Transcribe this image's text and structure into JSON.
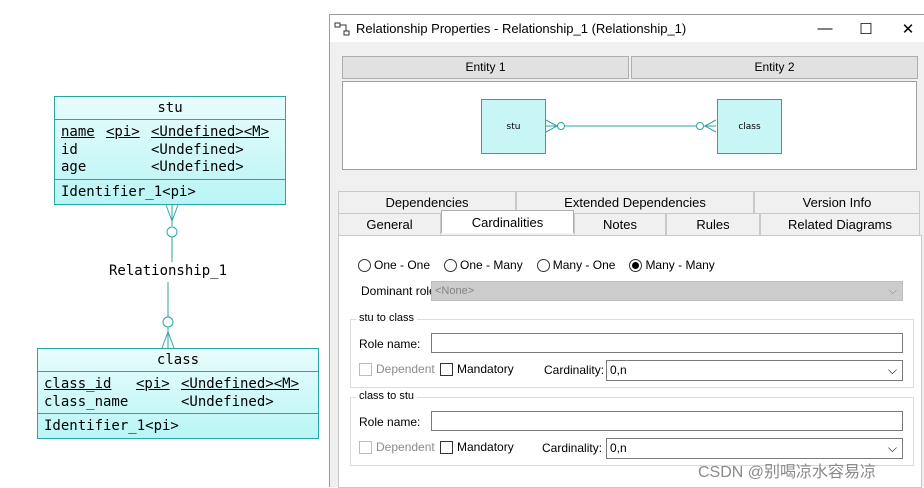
{
  "diagram": {
    "entity_stu": {
      "name": "stu",
      "attributes": [
        {
          "name": "name",
          "pi": "<pi>",
          "type": "<Undefined>",
          "mandatory": "<M>",
          "underline": true
        },
        {
          "name": "id",
          "pi": "",
          "type": "<Undefined>",
          "mandatory": "",
          "underline": false
        },
        {
          "name": "age",
          "pi": "",
          "type": "<Undefined>",
          "mandatory": "",
          "underline": false
        }
      ],
      "identifier": "Identifier_1<pi>"
    },
    "relationship_label": "Relationship_1",
    "entity_class": {
      "name": "class",
      "attributes": [
        {
          "name": "class_id",
          "pi": "<pi>",
          "type": "<Undefined>",
          "mandatory": "<M>",
          "underline": true
        },
        {
          "name": "class_name",
          "pi": "",
          "type": "<Undefined>",
          "mandatory": "",
          "underline": false
        }
      ],
      "identifier": "Identifier_1<pi>"
    }
  },
  "dialog": {
    "title": "Relationship Properties - Relationship_1 (Relationship_1)",
    "window_buttons": {
      "minimize": "—",
      "maximize": "☐",
      "close": "✕"
    },
    "entity_tabs": [
      "Entity 1",
      "Entity 2"
    ],
    "preview": {
      "left_entity": "stu",
      "right_entity": "class"
    },
    "tabs_row1": [
      "Dependencies",
      "Extended Dependencies",
      "Version Info"
    ],
    "tabs_row2": [
      "General",
      "Cardinalities",
      "Notes",
      "Rules",
      "Related Diagrams"
    ],
    "active_tab": "Cardinalities",
    "cardinality_options": [
      {
        "label": "One - One",
        "checked": false
      },
      {
        "label": "One - Many",
        "checked": false
      },
      {
        "label": "Many - One",
        "checked": false
      },
      {
        "label": "Many - Many",
        "checked": true
      }
    ],
    "dominant_role": {
      "label": "Dominant role:",
      "value": "<None>"
    },
    "group1": {
      "title": "stu to class",
      "role_name_label": "Role name:",
      "role_name_value": "",
      "dependent_label": "Dependent",
      "mandatory_label": "Mandatory",
      "cardinality_label": "Cardinality:",
      "cardinality_value": "0,n"
    },
    "group2": {
      "title": "class to stu",
      "role_name_label": "Role name:",
      "role_name_value": "",
      "dependent_label": "Dependent",
      "mandatory_label": "Mandatory",
      "cardinality_label": "Cardinality:",
      "cardinality_value": "0,n"
    }
  },
  "watermark": "CSDN @别喝凉水容易凉",
  "colors": {
    "entity_fill": "#c8f5f5",
    "entity_border": "#2aa5a5",
    "line": "#2aa5a5"
  }
}
